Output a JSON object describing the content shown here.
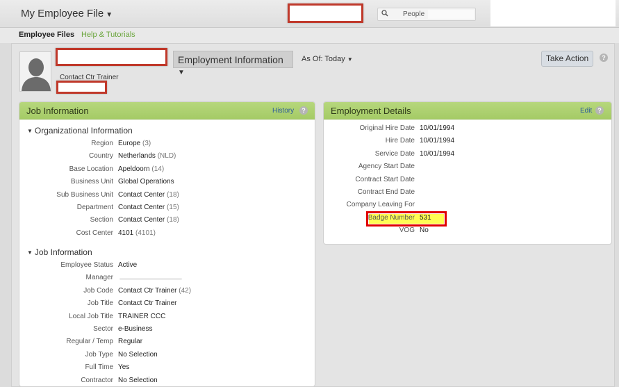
{
  "header": {
    "app_title": "My Employee File",
    "search_label": "People"
  },
  "subnav": {
    "tabs": [
      {
        "label": "Employee Files"
      },
      {
        "label": "Help & Tutorials"
      }
    ]
  },
  "profile": {
    "role": "Contact Ctr Trainer",
    "section_selector": "Employment Information",
    "as_of_label": "As Of:",
    "as_of_value": "Today",
    "take_action": "Take Action"
  },
  "job_panel": {
    "title": "Job Information",
    "history_link": "History",
    "org_group": "Organizational Information",
    "org_rows": [
      {
        "label": "Region",
        "value": "Europe",
        "extra": "(3)"
      },
      {
        "label": "Country",
        "value": "Netherlands",
        "extra": "(NLD)"
      },
      {
        "label": "Base Location",
        "value": "Apeldoorn",
        "extra": "(14)"
      },
      {
        "label": "Business Unit",
        "value": "Global Operations",
        "extra": ""
      },
      {
        "label": "Sub Business Unit",
        "value": "Contact Center",
        "extra": "(18)"
      },
      {
        "label": "Department",
        "value": "Contact Center",
        "extra": "(15)"
      },
      {
        "label": "Section",
        "value": "Contact Center",
        "extra": "(18)"
      },
      {
        "label": "Cost Center",
        "value": "4101",
        "extra": "(4101)"
      }
    ],
    "job_group": "Job Information",
    "job_rows": [
      {
        "label": "Employee Status",
        "value": "Active",
        "extra": ""
      },
      {
        "label": "Manager",
        "value": "",
        "extra": ""
      },
      {
        "label": "Job Code",
        "value": "Contact Ctr Trainer",
        "extra": "(42)"
      },
      {
        "label": "Job Title",
        "value": "Contact Ctr Trainer",
        "extra": ""
      },
      {
        "label": "Local Job Title",
        "value": "TRAINER CCC",
        "extra": ""
      },
      {
        "label": "Sector",
        "value": "e-Business",
        "extra": ""
      },
      {
        "label": "Regular / Temp",
        "value": "Regular",
        "extra": ""
      },
      {
        "label": "Job Type",
        "value": "No Selection",
        "extra": ""
      },
      {
        "label": "Full Time",
        "value": "Yes",
        "extra": ""
      },
      {
        "label": "Contractor",
        "value": "No Selection",
        "extra": ""
      }
    ]
  },
  "employment_panel": {
    "title": "Employment Details",
    "edit_link": "Edit",
    "rows": [
      {
        "label": "Original Hire Date",
        "value": "10/01/1994"
      },
      {
        "label": "Hire Date",
        "value": "10/01/1994"
      },
      {
        "label": "Service Date",
        "value": "10/01/1994"
      },
      {
        "label": "Agency Start Date",
        "value": ""
      },
      {
        "label": "Contract Start Date",
        "value": ""
      },
      {
        "label": "Contract End Date",
        "value": ""
      },
      {
        "label": "Company Leaving For",
        "value": ""
      },
      {
        "label": "Badge Number",
        "value": "531"
      },
      {
        "label": "VOG",
        "value": "No"
      }
    ]
  }
}
